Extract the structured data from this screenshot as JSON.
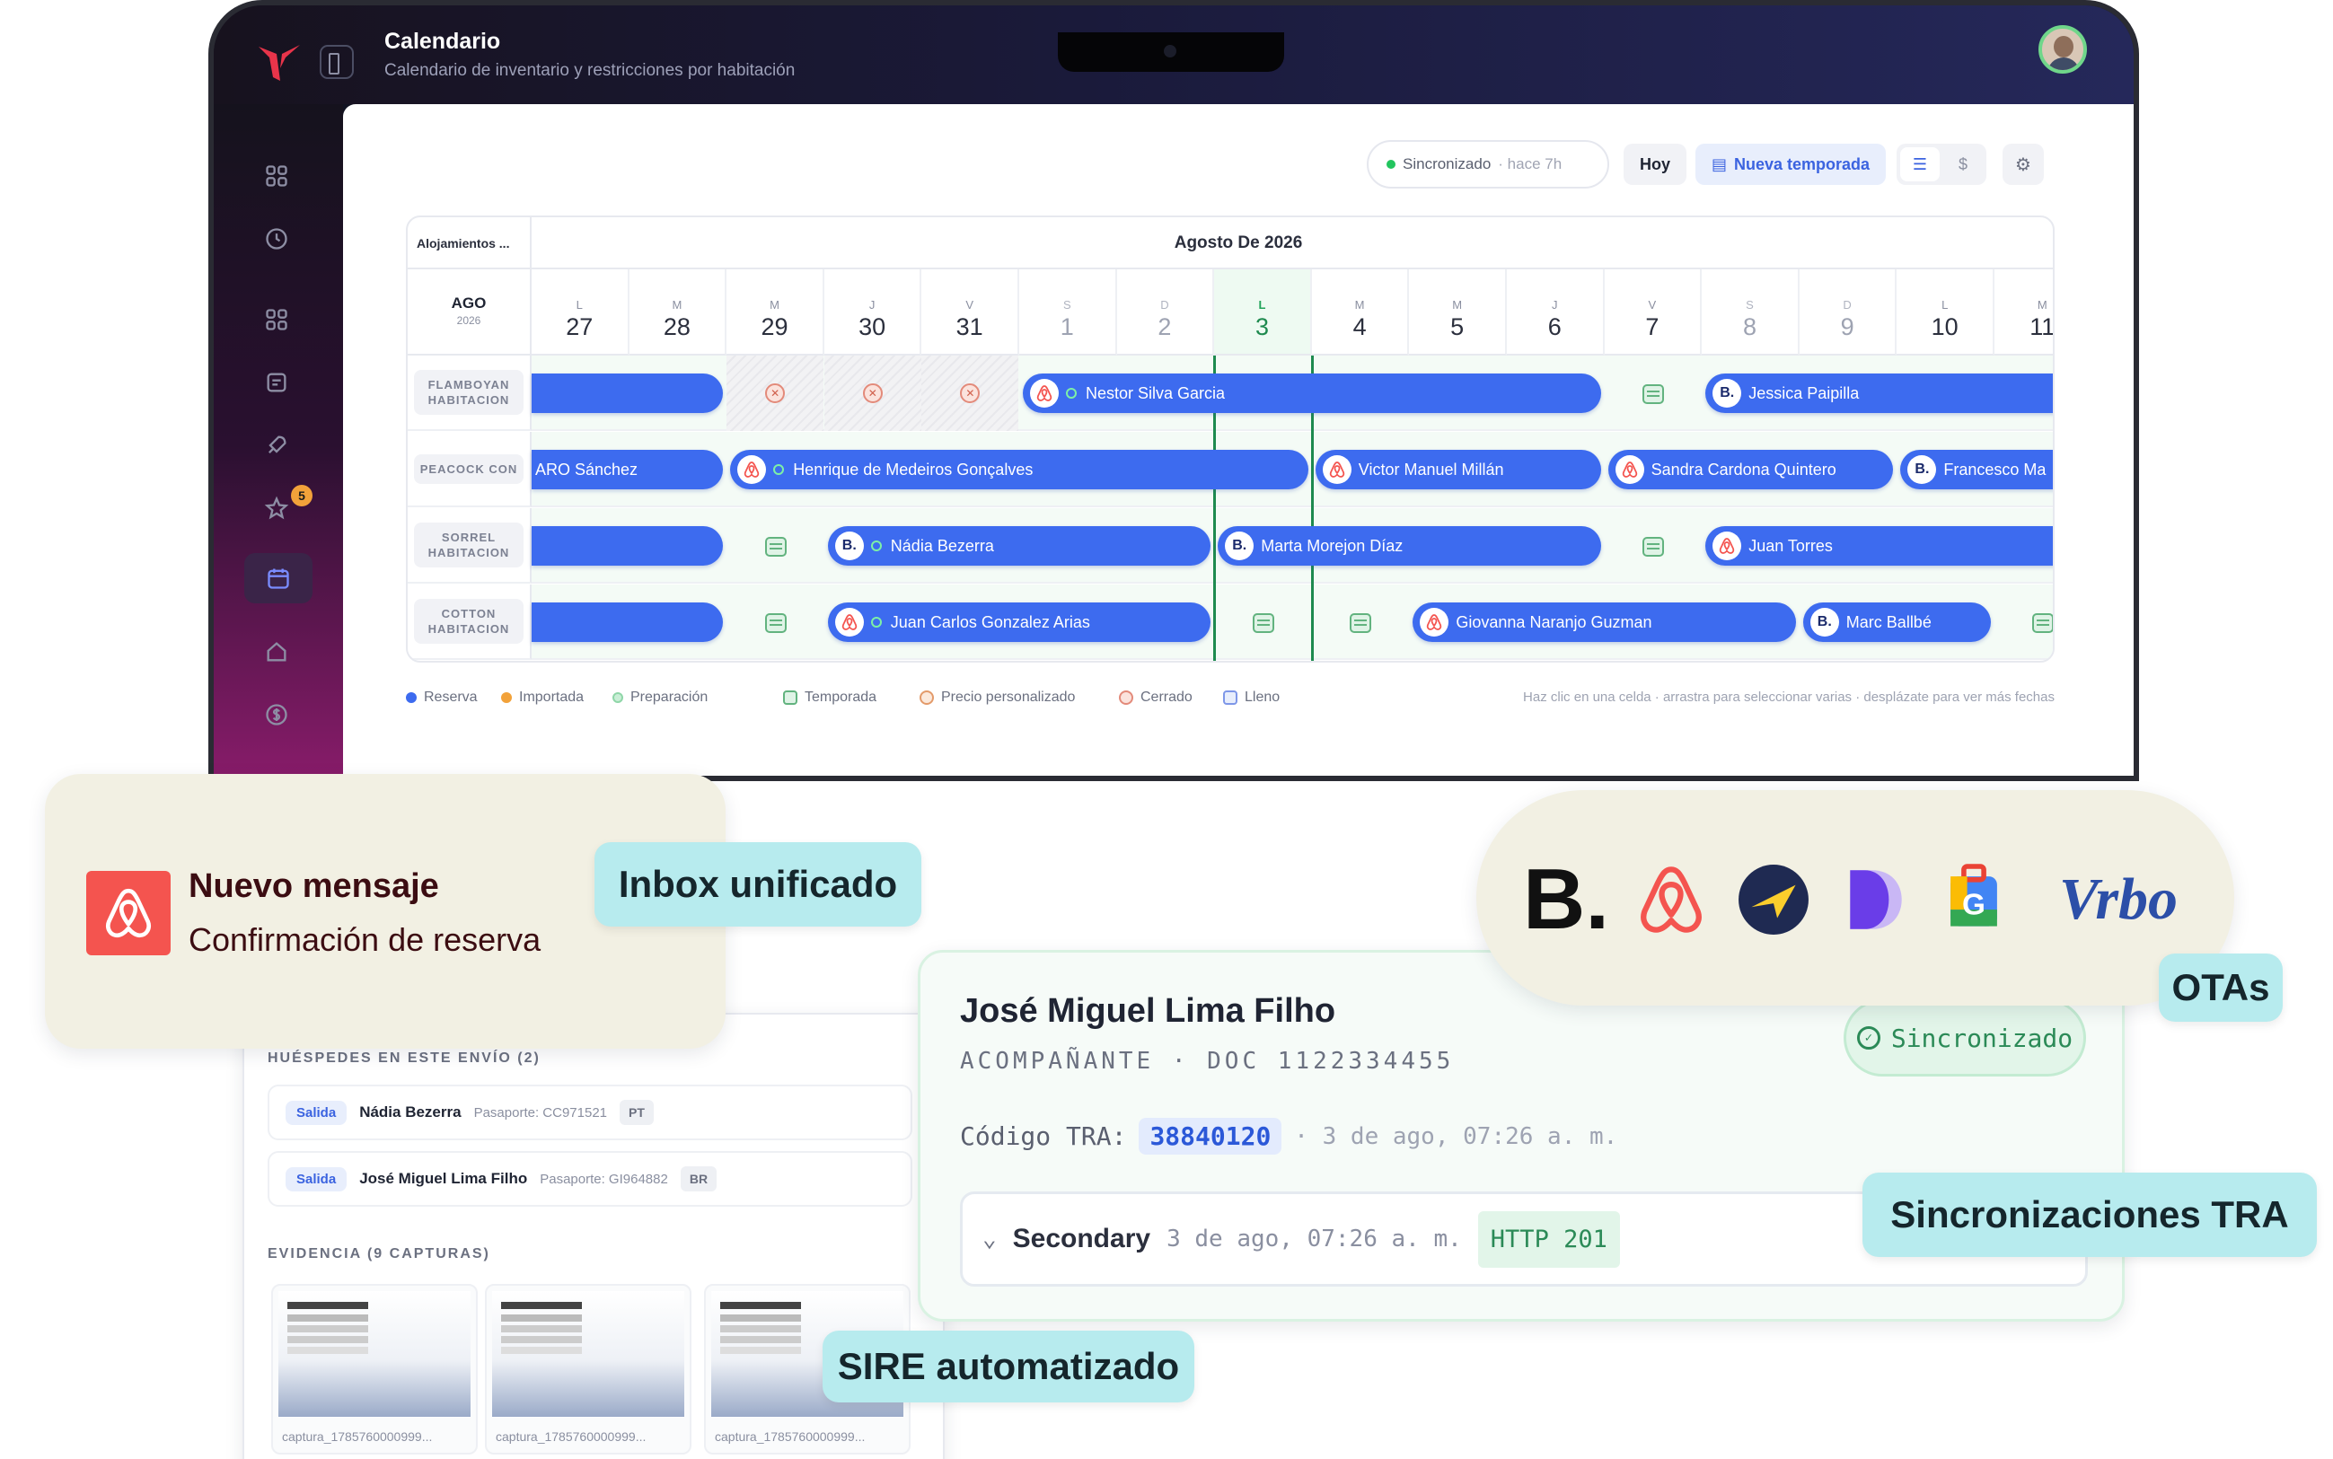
{
  "app": {
    "title": "Calendario",
    "subtitle": "Calendario de inventario y restricciones por habitación",
    "badge_count": "5"
  },
  "toolbar": {
    "sync_label": "Sincronizado",
    "sync_ago": "· hace 7h",
    "today_label": "Hoy",
    "new_season_label": "Nueva temporada"
  },
  "calendar": {
    "accommodations_label": "Alojamientos ...",
    "month_title": "Agosto De 2026",
    "corner_month": "AGO",
    "corner_year": "2026",
    "days": [
      {
        "wd": "L",
        "n": "27"
      },
      {
        "wd": "M",
        "n": "28"
      },
      {
        "wd": "M",
        "n": "29"
      },
      {
        "wd": "J",
        "n": "30"
      },
      {
        "wd": "V",
        "n": "31"
      },
      {
        "wd": "S",
        "n": "1"
      },
      {
        "wd": "D",
        "n": "2"
      },
      {
        "wd": "L",
        "n": "3"
      },
      {
        "wd": "M",
        "n": "4"
      },
      {
        "wd": "M",
        "n": "5"
      },
      {
        "wd": "J",
        "n": "6"
      },
      {
        "wd": "V",
        "n": "7"
      },
      {
        "wd": "S",
        "n": "8"
      },
      {
        "wd": "D",
        "n": "9"
      },
      {
        "wd": "L",
        "n": "10"
      },
      {
        "wd": "M",
        "n": "11"
      }
    ],
    "units": [
      {
        "name": "FLAMBOYAN HABITACION"
      },
      {
        "name": "PEACOCK CON"
      },
      {
        "name": "SORREL HABITACION"
      },
      {
        "name": "COTTON HABITACION"
      }
    ],
    "reservations": {
      "r0b": "Nestor Silva Garcia",
      "r0c": "Jessica Paipilla",
      "r1a": "ARO Sánchez",
      "r1b": "Henrique de Medeiros Gonçalves",
      "r1c": "Victor Manuel Millán",
      "r1d": "Sandra Cardona Quintero",
      "r1e": "Francesco Ma",
      "r2b": "Nádia Bezerra",
      "r2c": "Marta Morejon Díaz",
      "r2d": "Juan Torres",
      "r3b": "Juan Carlos Gonzalez Arias",
      "r3c": "Giovanna Naranjo Guzman",
      "r3d": "Marc Ballbé"
    },
    "legend": {
      "reserva": "Reserva",
      "importada": "Importada",
      "preparacion": "Preparación",
      "temporada": "Temporada",
      "precio": "Precio personalizado",
      "cerrado": "Cerrado",
      "lleno": "Lleno",
      "hint": "Haz clic en una celda · arrastra para seleccionar varias · desplázate para ver más fechas"
    }
  },
  "guests": {
    "title": "HUÉSPEDES EN ESTE ENVÍO (2)",
    "rows": [
      {
        "status": "Salida",
        "name": "Nádia Bezerra",
        "passport": "Pasaporte: CC971521",
        "nat": "PT"
      },
      {
        "status": "Salida",
        "name": "José Miguel Lima Filho",
        "passport": "Pasaporte: GI964882",
        "nat": "BR"
      }
    ],
    "evidence_title": "EVIDENCIA (9 CAPTURAS)",
    "captures": [
      "captura_1785760000999...",
      "captura_1785760000999...",
      "captura_1785760000999..."
    ]
  },
  "tra": {
    "name": "José Miguel Lima Filho",
    "role": "ACOMPAÑANTE · DOC 1122334455",
    "status": "Sincronizado",
    "code_label": "Código TRA:",
    "code": "38840120",
    "code_time": "· 3 de ago, 07:26 a. m.",
    "secondary_label": "Secondary",
    "secondary_time": "3 de ago, 07:26 a. m.",
    "http": "HTTP 201"
  },
  "message": {
    "title": "Nuevo mensaje",
    "body": "Confirmación de reserva"
  },
  "otas": {
    "booking": "B.",
    "vrbo": "Vrbo"
  },
  "chips": {
    "inbox": "Inbox unificado",
    "otas": "OTAs",
    "tra": "Sincronizaciones TRA",
    "sire": "SIRE automatizado"
  },
  "colors": {
    "reservation": "#3d6bef",
    "today": "#1e8a4f",
    "chip": "#b7ebee",
    "card_cream": "#f2f0e3",
    "airbnb": "#f4544f"
  }
}
